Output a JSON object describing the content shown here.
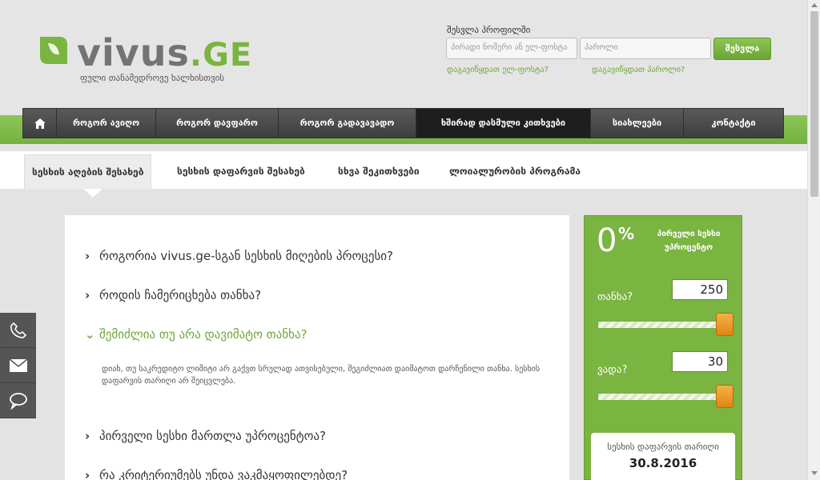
{
  "header": {
    "logo_text_main": "vivus",
    "logo_text_suffix": ".GE",
    "tagline": "ფული თანამედროვე ხალხისთვის",
    "login": {
      "label": "შესვლა პროფილში",
      "user_placeholder": "პირადი ნომერი ან ელ-ფოსტა",
      "password_placeholder": "პაროლი",
      "submit_label": "შესვლა",
      "forgot_email": "დაგავიწყდათ ელ-ფოსტა?",
      "forgot_password": "დაგავიწყდათ პაროლი?"
    }
  },
  "nav": {
    "home_icon": "home-icon",
    "items": [
      {
        "label": "როგორ ავიღო"
      },
      {
        "label": "როგორ დავფარო"
      },
      {
        "label": "როგორ გადავავადო"
      },
      {
        "label": "ხშირად დასმული კითხვები",
        "active": true
      },
      {
        "label": "სიახლეები"
      },
      {
        "label": "კონტაქტი"
      }
    ]
  },
  "subtabs": [
    {
      "label": "სესხის აღების შესახებ",
      "active": true
    },
    {
      "label": "სესხის დაფარვის შესახებ"
    },
    {
      "label": "სხვა შეკითხვები"
    },
    {
      "label": "ლოიალურობის პროგრამა"
    }
  ],
  "faq": {
    "questions": [
      {
        "text": "როგორია vivus.ge-სგან სესხის მიღების პროცესი?"
      },
      {
        "text": "როდის ჩამერიცხება თანხა?"
      },
      {
        "text": "შემიძლია თუ არა დავიმატო თანხა?",
        "open": true
      },
      {
        "text": "პირველი სესხი მართლა უპროცენტოა?"
      },
      {
        "text": "რა კრიტერიუმებს უნდა ვაკმაყოფილებდე?"
      }
    ],
    "answer": "დიახ, თუ საკრედიტო ლიმიტი არ გაქვთ სრულად ათვისებული, შეგიძლიათ დაიმატოთ დარჩენილი თანხა. სესხის დაფარვის თარიღი არ შეიცვლება."
  },
  "side_contact": {
    "icons": [
      "phone-icon",
      "mail-icon",
      "chat-icon"
    ]
  },
  "calculator": {
    "zero": "0",
    "percent": "%",
    "promo": "პირველი სესხი უპროცენტო",
    "amount_label": "თანხა?",
    "amount_value": "250",
    "amount_fraction": 1.0,
    "term_label": "ვადა?",
    "term_value": "30",
    "term_fraction": 1.0,
    "due_label": "სესხის დაფარვის თარიღი",
    "due_date": "30.8.2016"
  },
  "colors": {
    "brand_green": "#7ab441",
    "nav_dark": "#3e3e3e",
    "slider_orange": "#f0a030"
  }
}
